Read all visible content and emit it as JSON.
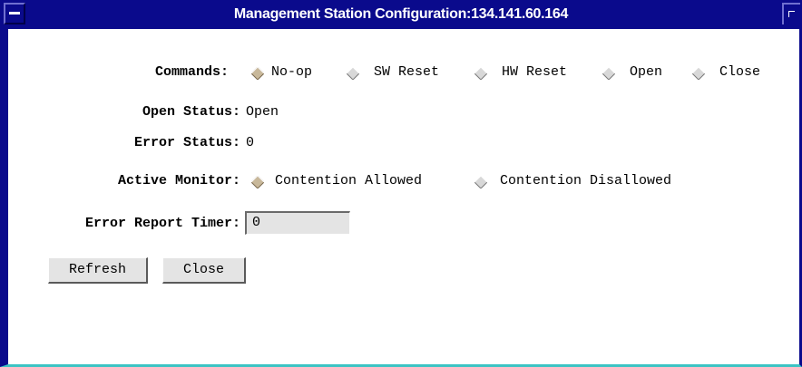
{
  "window": {
    "title": "Management Station Configuration:134.141.60.164"
  },
  "colors": {
    "titlebar": "#0a0a8c",
    "frame_bottom": "#3cc4c4",
    "radio_selected": "#c8b89a",
    "radio_unselected": "#d8d8d8",
    "field_bg": "#e4e4e4"
  },
  "commands": {
    "label": "Commands:",
    "selected": "No-op",
    "options": [
      {
        "label": "No-op",
        "selected": true
      },
      {
        "label": "SW Reset",
        "selected": false
      },
      {
        "label": "HW Reset",
        "selected": false
      },
      {
        "label": "Open",
        "selected": false
      },
      {
        "label": "Close",
        "selected": false
      }
    ]
  },
  "open_status": {
    "label": "Open Status:",
    "value": "Open"
  },
  "error_status": {
    "label": "Error Status:",
    "value": "0"
  },
  "active_monitor": {
    "label": "Active Monitor:",
    "selected": "Contention Allowed",
    "options": [
      {
        "label": "Contention Allowed",
        "selected": true
      },
      {
        "label": "Contention Disallowed",
        "selected": false
      }
    ]
  },
  "error_report_timer": {
    "label": "Error Report Timer:",
    "value": "0"
  },
  "buttons": {
    "refresh": "Refresh",
    "close": "Close"
  },
  "icons": {
    "window_menu": "window-menu-icon",
    "resize": "resize-corner-icon",
    "radio_selected": "diamond-radio-selected-icon",
    "radio_unselected": "diamond-radio-unselected-icon"
  }
}
